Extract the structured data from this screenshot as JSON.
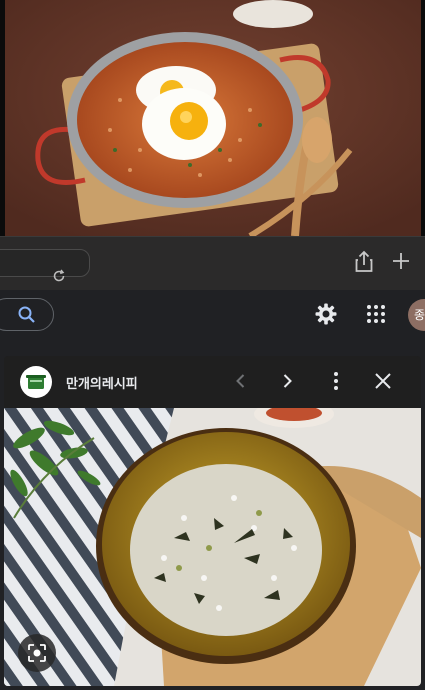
{
  "google": {
    "avatar_initial": "종"
  },
  "viewer": {
    "site_name": "만개의레시피"
  },
  "icons": {
    "reload": "reload-icon",
    "share": "share-icon",
    "new_tab": "plus-icon",
    "search": "search-icon",
    "settings": "gear-icon",
    "apps": "apps-grid-icon",
    "prev": "chevron-left-icon",
    "next": "chevron-right-icon",
    "more": "more-vert-icon",
    "close": "close-icon",
    "lens": "lens-icon"
  },
  "colors": {
    "browser_bg": "#2b2a2a",
    "google_bg": "#202124",
    "avatar_bg": "#8d6e63"
  }
}
